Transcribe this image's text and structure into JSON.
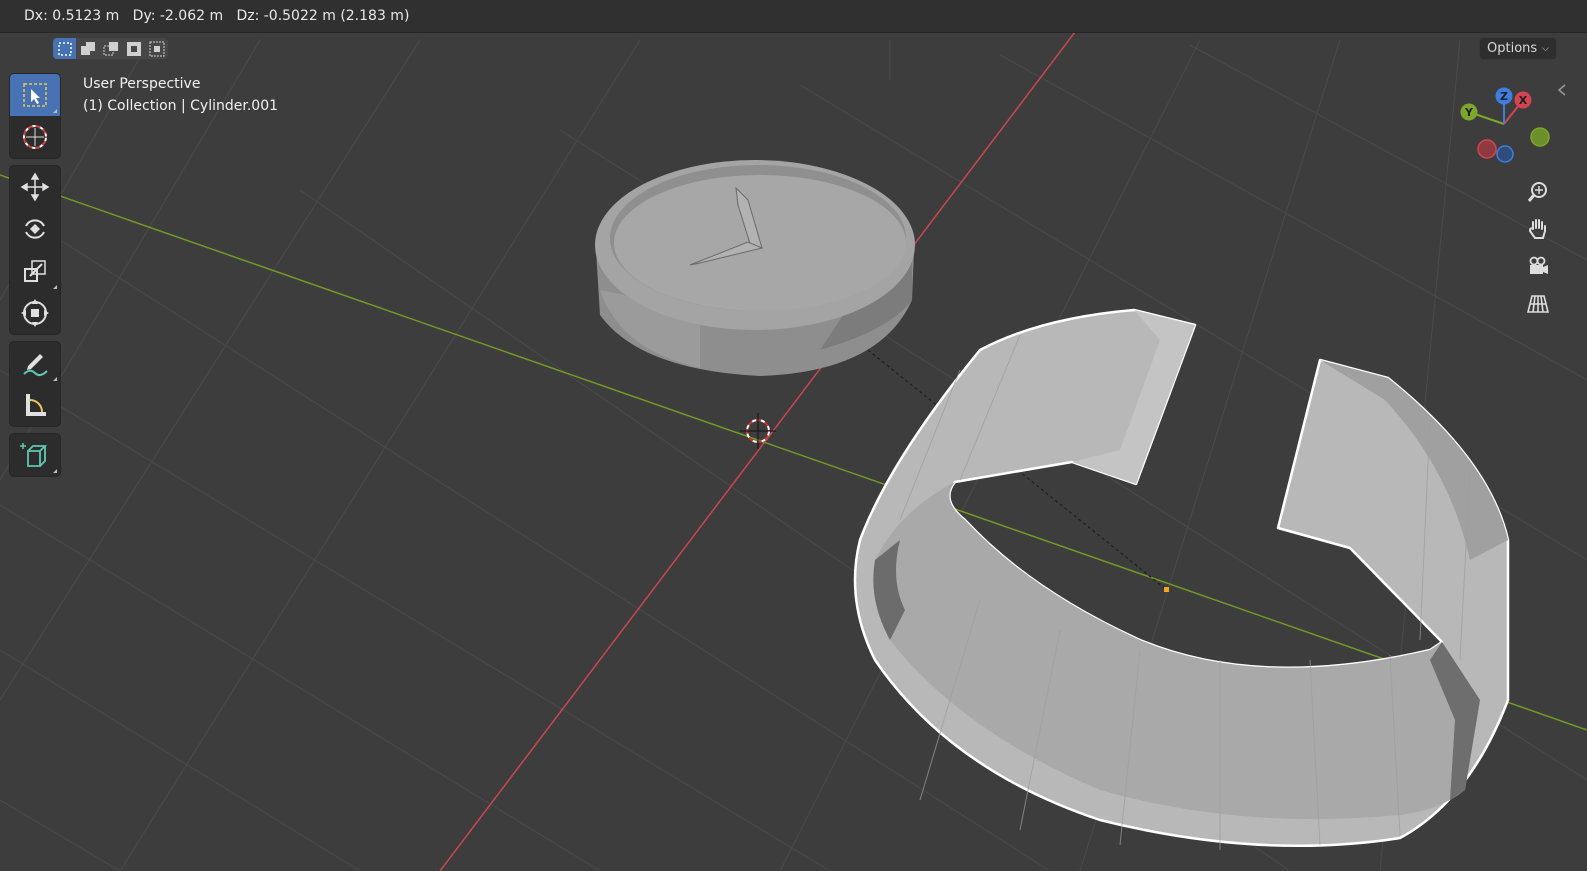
{
  "header": {
    "measurement": "Dx: 0.5123 m   Dy: -2.062 m   Dz: -0.5022 m (2.183 m)"
  },
  "options": {
    "label": "Options"
  },
  "viewport": {
    "perspective_label": "User Perspective",
    "object_label": "(1) Collection | Cylinder.001"
  },
  "select_modes": [
    {
      "icon": "select-box-new-icon",
      "active": true
    },
    {
      "icon": "select-box-extend-icon",
      "active": false
    },
    {
      "icon": "select-box-subtract-icon",
      "active": false
    },
    {
      "icon": "select-box-invert-icon",
      "active": false
    },
    {
      "icon": "select-box-intersect-icon",
      "active": false
    }
  ],
  "toolbar": {
    "tools": [
      {
        "icon": "select-box-icon",
        "active": true
      },
      {
        "icon": "cursor-icon",
        "active": false
      },
      {
        "icon": "move-icon",
        "active": false
      },
      {
        "icon": "rotate-icon",
        "active": false
      },
      {
        "icon": "scale-icon",
        "active": false
      },
      {
        "icon": "transform-icon",
        "active": false
      },
      {
        "icon": "annotate-icon",
        "active": false
      },
      {
        "icon": "measure-icon",
        "active": false
      },
      {
        "icon": "add-cube-icon",
        "active": false
      }
    ]
  },
  "gizmo": {
    "x": "X",
    "y": "Y",
    "z": "Z"
  },
  "nav": [
    "zoom-icon",
    "pan-hand-icon",
    "camera-icon",
    "ortho-grid-icon"
  ],
  "colors": {
    "background": "#3d3d3d",
    "grid": "#4a4a4a",
    "x_axis": "#c8474e",
    "y_axis": "#6f9a26",
    "accent": "#4772b3",
    "mesh": "#9a9a9a",
    "selection_outline": "#ffffff"
  }
}
